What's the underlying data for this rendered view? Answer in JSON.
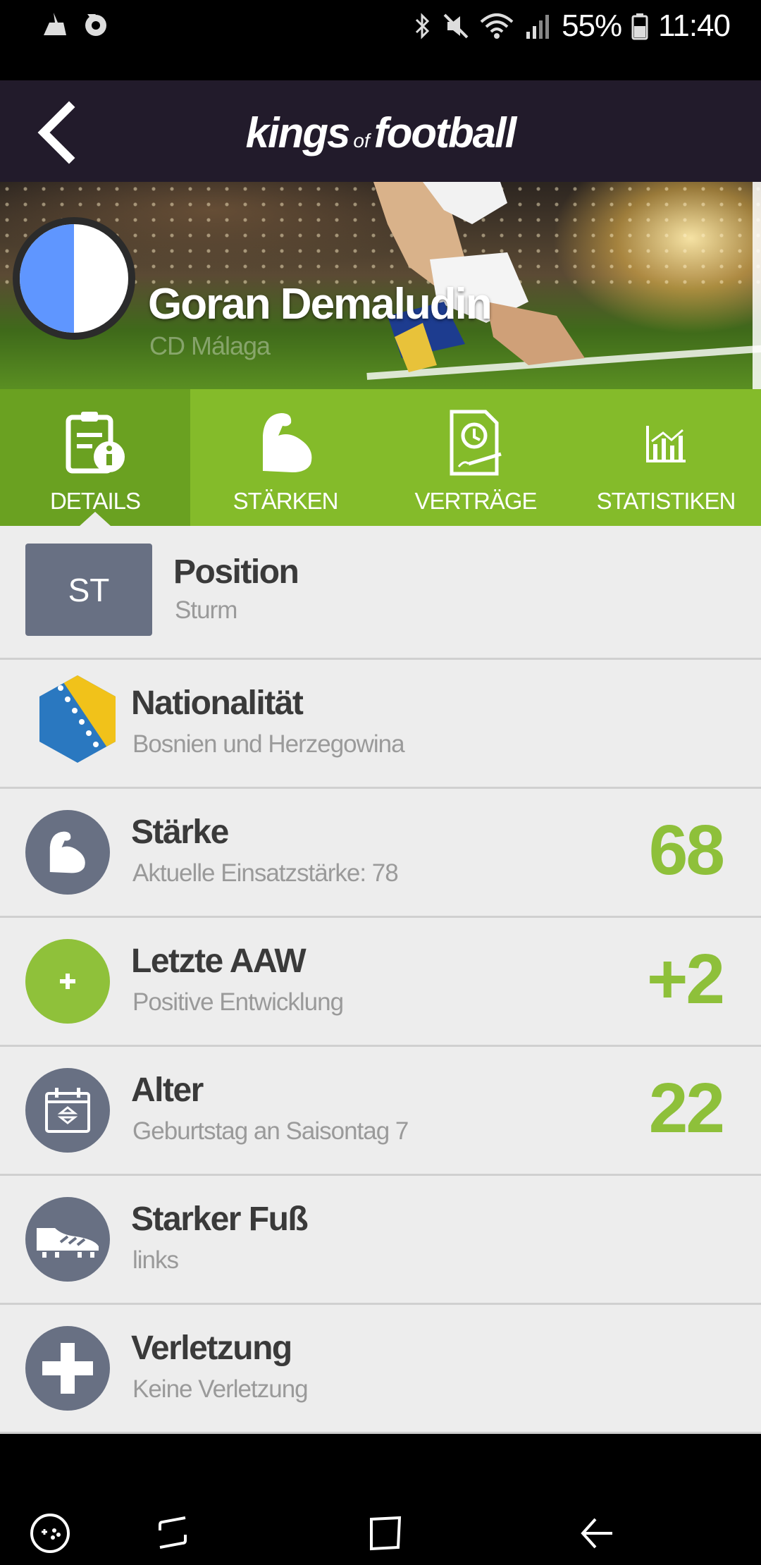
{
  "status_bar": {
    "battery": "55%",
    "time": "11:40"
  },
  "app_bar": {
    "logo_part1": "kings",
    "logo_of": "of",
    "logo_part2": "football"
  },
  "player": {
    "name": "Goran Demaludin",
    "club": "CD Málaga",
    "avatar_colors": [
      "#5f96ff",
      "#ffffff"
    ]
  },
  "tabs": [
    {
      "label": "DETAILS",
      "icon": "details-info-icon",
      "active": true
    },
    {
      "label": "STÄRKEN",
      "icon": "biceps-icon",
      "active": false
    },
    {
      "label": "VERTRÄGE",
      "icon": "contract-clock-icon",
      "active": false
    },
    {
      "label": "STATISTIKEN",
      "icon": "bar-chart-icon",
      "active": false
    }
  ],
  "details": {
    "position": {
      "chip": "ST",
      "title": "Position",
      "subtitle": "Sturm"
    },
    "nationality": {
      "title": "Nationalität",
      "subtitle": "Bosnien und Herzegowina",
      "icon": "bosnia-flag-icon"
    },
    "strength": {
      "title": "Stärke",
      "subtitle": "Aktuelle Einsatzstärke: 78",
      "value": "68",
      "icon": "biceps-icon"
    },
    "last_aaw": {
      "title": "Letzte AAW",
      "subtitle": "Positive Entwicklung",
      "value": "+2",
      "icon": "plus-icon"
    },
    "age": {
      "title": "Alter",
      "subtitle": "Geburtstag an Saisontag 7",
      "value": "22",
      "icon": "calendar-icon"
    },
    "foot": {
      "title": "Starker Fuß",
      "subtitle": "links",
      "icon": "football-boot-icon"
    },
    "injury": {
      "title": "Verletzung",
      "subtitle": "Keine Verletzung",
      "icon": "medical-cross-icon"
    }
  },
  "colors": {
    "header_bg": "#221b2b",
    "tab_green": "#84bb2a",
    "tab_active": "#6aa121",
    "value_green": "#8ec03a",
    "icon_slate": "#687083"
  }
}
